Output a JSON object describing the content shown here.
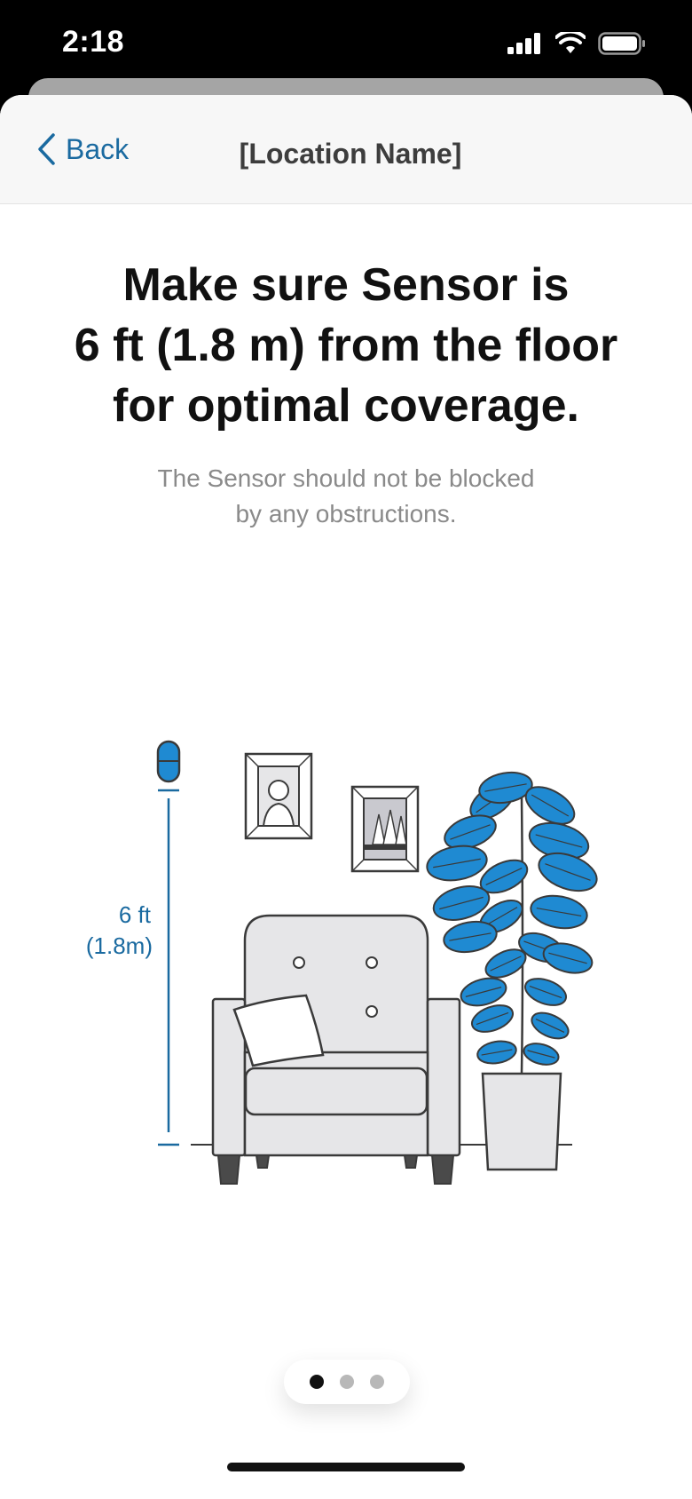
{
  "status_bar": {
    "time": "2:18",
    "icons": [
      "cellular-signal-icon",
      "wifi-icon",
      "battery-icon"
    ]
  },
  "nav": {
    "back_label": "Back",
    "title": "[Location Name]",
    "back_icon": "chevron-left-icon"
  },
  "content": {
    "headline_line1": "Make sure Sensor is",
    "headline_line2": "6 ft (1.8 m) from the floor",
    "headline_line3": "for optimal coverage.",
    "subtext_line1": "The Sensor should not be blocked",
    "subtext_line2": "by any obstructions."
  },
  "illustration": {
    "height_label_ft": "6 ft",
    "height_label_m": "(1.8m)",
    "objects": [
      "sensor-icon",
      "picture-frame-portrait",
      "picture-frame-trees",
      "armchair",
      "cushion",
      "potted-plant"
    ]
  },
  "pager": {
    "total": 3,
    "current": 1
  },
  "colors": {
    "accent": "#1a6aa0",
    "leaf": "#1f8ad2",
    "outline": "#3a3a3a",
    "furniture": "#e6e6e8"
  }
}
